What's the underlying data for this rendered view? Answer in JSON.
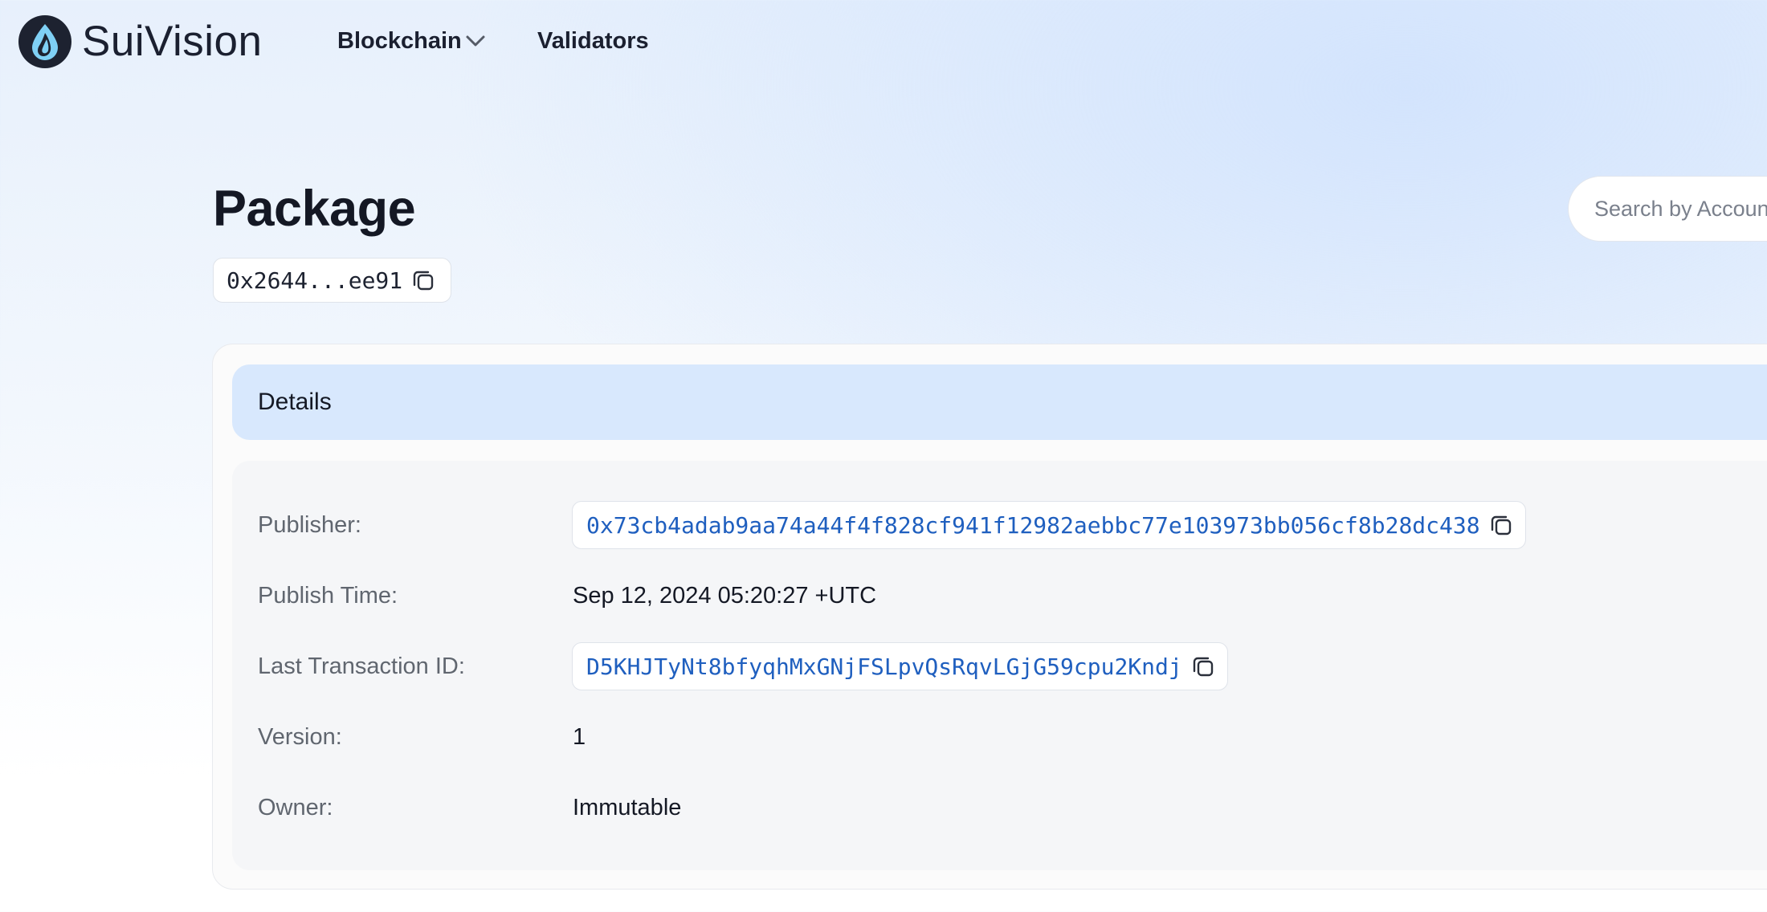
{
  "brand": {
    "name": "SuiVision"
  },
  "nav": {
    "items": [
      {
        "label": "Blockchain"
      },
      {
        "label": "Validators"
      }
    ]
  },
  "search": {
    "placeholder": "Search by Account"
  },
  "page": {
    "title": "Package",
    "short_address": "0x2644...ee91"
  },
  "details": {
    "title": "Details",
    "rows": [
      {
        "label": "Publisher:",
        "value": "0x73cb4adab9aa74a44f4f828cf941f12982aebbc77e103973bb056cf8b28dc438"
      },
      {
        "label": "Publish Time:",
        "value": "Sep 12, 2024 05:20:27 +UTC"
      },
      {
        "label": "Last Transaction ID:",
        "value": "D5KHJTyNt8bfyqhMxGNjFSLpvQsRqvLGjG59cpu2Kndj"
      },
      {
        "label": "Version:",
        "value": "1"
      },
      {
        "label": "Owner:",
        "value": "Immutable"
      }
    ]
  },
  "colors": {
    "accent": "#1f5fbf",
    "header_bg": "#d8e8fd",
    "logo_drop": "#7fd0f5"
  },
  "icons": {
    "logo": "water-drop-icon",
    "copy": "copy-icon",
    "chevron": "chevron-down-icon"
  }
}
